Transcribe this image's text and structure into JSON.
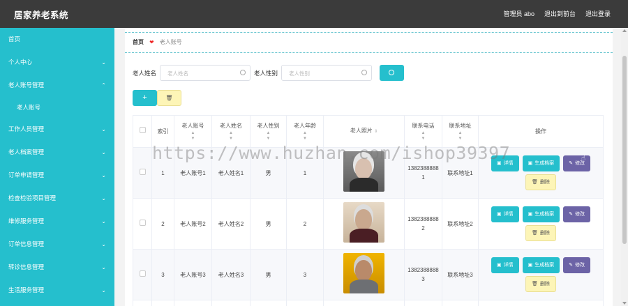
{
  "app": {
    "title": "居家养老系统"
  },
  "topbar": {
    "user": "管理员 abo",
    "back": "退出到前台",
    "logout": "退出登录"
  },
  "sidebar": {
    "home": "首页",
    "items": [
      {
        "label": "个人中心"
      },
      {
        "label": "老人账号管理"
      },
      {
        "label": "工作人员管理"
      },
      {
        "label": "老人档案管理"
      },
      {
        "label": "订单申请管理"
      },
      {
        "label": "检查检验项目管理"
      },
      {
        "label": "维修服务管理"
      },
      {
        "label": "订单信息管理"
      },
      {
        "label": "转诊信息管理"
      },
      {
        "label": "生活服务管理"
      }
    ],
    "sub_item": "老人账号"
  },
  "breadcrumb": {
    "home": "首页",
    "current": "老人账号"
  },
  "search": {
    "name_label": "老人姓名",
    "name_placeholder": "老人姓名",
    "gender_label": "老人性别",
    "gender_placeholder": "老人性别"
  },
  "actions": {
    "add": "+",
    "delete": "🗑"
  },
  "table": {
    "columns": [
      "索引",
      "老人账号",
      "老人姓名",
      "老人性别",
      "老人年龄",
      "老人照片",
      "联系电话",
      "联系地址",
      "操作"
    ],
    "rows": [
      {
        "index": "1",
        "account": "老人账号1",
        "name": "老人姓名1",
        "gender": "男",
        "age": "1",
        "phone": "13823888881",
        "address": "联系地址1"
      },
      {
        "index": "2",
        "account": "老人账号2",
        "name": "老人姓名2",
        "gender": "男",
        "age": "2",
        "phone": "13823888882",
        "address": "联系地址2"
      },
      {
        "index": "3",
        "account": "老人账号3",
        "name": "老人姓名3",
        "gender": "男",
        "age": "3",
        "phone": "13823888883",
        "address": "联系地址3"
      }
    ],
    "ops": {
      "detail": "详情",
      "generate": "生成档案",
      "edit": "修改",
      "remove": "删除"
    }
  },
  "watermark": "https://www.huzhan.com/ishop39397",
  "colors": {
    "accent": "#25bfcd",
    "topbar": "#3b3b3b",
    "edit": "#6c63a6",
    "danger_bg": "#fdf5b7"
  }
}
